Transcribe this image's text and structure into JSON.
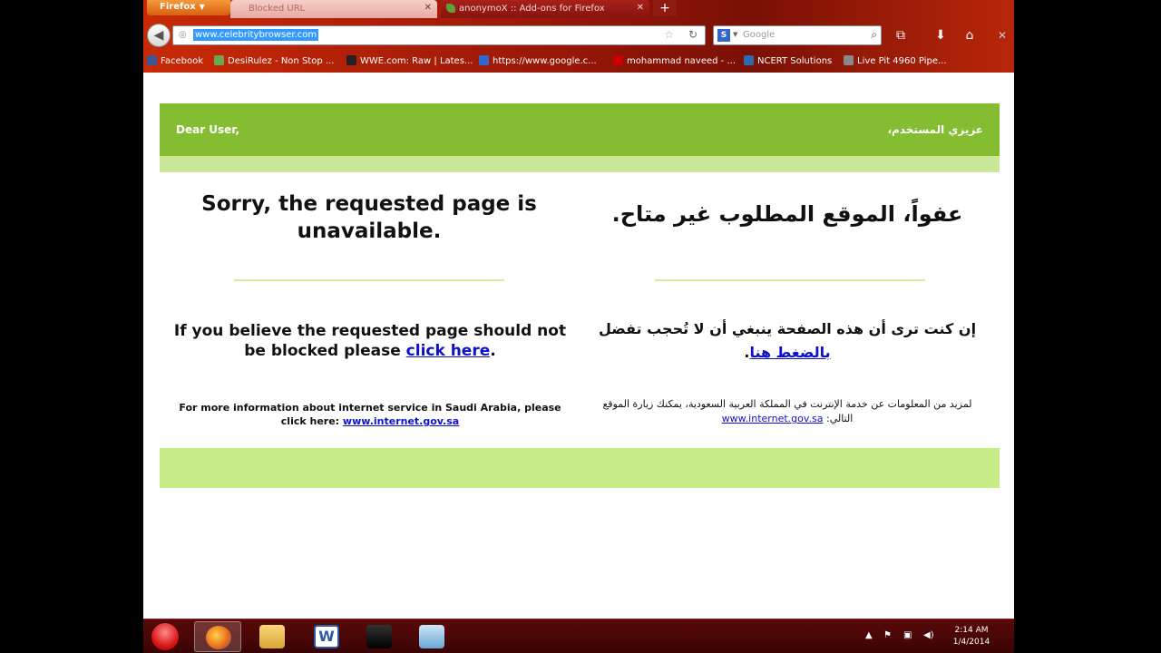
{
  "browser": {
    "menu_label": "Firefox",
    "tabs": [
      {
        "title": "Blocked URL",
        "active": true
      },
      {
        "title": "anonymoX :: Add-ons for Firefox",
        "active": false
      }
    ],
    "new_tab_label": "+",
    "url": "www.celebritybrowser.com",
    "search_engine_letter": "S",
    "search_placeholder": "Google",
    "bookmarks": [
      {
        "label": "Facebook",
        "icon": "facebook-icon",
        "color": "#3b5998"
      },
      {
        "label": "DesiRulez - Non Stop ...",
        "icon": "desirulez-icon",
        "color": "#6aa84f"
      },
      {
        "label": "WWE.com: Raw | Lates...",
        "icon": "wwe-icon",
        "color": "#222222"
      },
      {
        "label": "https://www.google.c...",
        "icon": "google-icon",
        "color": "#3366cc"
      },
      {
        "label": "mohammad naveed - ...",
        "icon": "youtube-icon",
        "color": "#cc0000"
      },
      {
        "label": "NCERT Solutions",
        "icon": "ncert-icon",
        "color": "#2b6cb0"
      },
      {
        "label": "Live Pit 4960 Pipe...",
        "icon": "livepit-icon",
        "color": "#888888"
      }
    ]
  },
  "page": {
    "greeting_en": "Dear User,",
    "greeting_ar": "عزيزي المستخدم،",
    "title_en": "Sorry, the requested page is unavailable.",
    "title_ar": "عفواً، الموقع المطلوب غير متاح.",
    "blocked_en_prefix": "If you believe the requested page should not be blocked please ",
    "blocked_en_link": "click here",
    "blocked_en_suffix": ".",
    "blocked_ar_prefix": "إن كنت ترى أن هذه الصفحة ينبغي أن لا تُحجب تفضل ",
    "blocked_ar_link": "بالضغط هنا",
    "blocked_ar_suffix": ".",
    "info_en_prefix": "For more information about internet service in Saudi Arabia, please click here: ",
    "info_en_link": "www.internet.gov.sa",
    "info_ar_prefix": "لمزيد من المعلومات عن خدمة الإنترنت في المملكة العربية السعودية، يمكنك زيارة الموقع التالي: ",
    "info_ar_link": "www.internet.gov.sa"
  },
  "colors": {
    "banner": "#84bd31",
    "banner_strip": "#cbe89a",
    "footer_bar": "#c7eb86",
    "link": "#1010cc"
  },
  "taskbar": {
    "word_letter": "W",
    "clock_time": "2:14 AM",
    "clock_date": "1/4/2014"
  }
}
